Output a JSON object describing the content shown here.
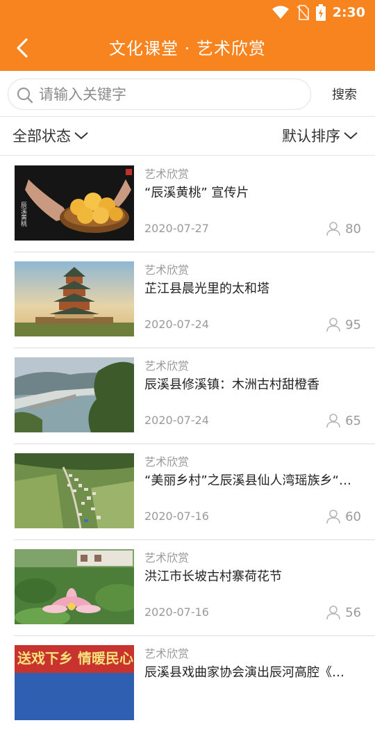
{
  "status_bar": {
    "time": "2:30"
  },
  "header": {
    "title": "文化课堂 · 艺术欣赏"
  },
  "search": {
    "placeholder": "请输入关键字",
    "button_label": "搜索"
  },
  "filters": {
    "status_label": "全部状态",
    "sort_label": "默认排序"
  },
  "items": [
    {
      "category": "艺术欣赏",
      "title": "“辰溪黄桃” 宣传片",
      "date": "2020-07-27",
      "views": "80"
    },
    {
      "category": "艺术欣赏",
      "title": "芷江县晨光里的太和塔",
      "date": "2020-07-24",
      "views": "95"
    },
    {
      "category": "艺术欣赏",
      "title": "辰溪县修溪镇：木洲古村甜橙香",
      "date": "2020-07-24",
      "views": "65"
    },
    {
      "category": "艺术欣赏",
      "title": "“美丽乡村”之辰溪县仙人湾瑶族乡“…",
      "date": "2020-07-16",
      "views": "60"
    },
    {
      "category": "艺术欣赏",
      "title": "洪江市长坡古村寨荷花节",
      "date": "2020-07-16",
      "views": "56"
    },
    {
      "category": "艺术欣赏",
      "title": "辰溪县戏曲家协会演出辰河高腔《…",
      "date": "",
      "views": ""
    }
  ],
  "thumbnail_captions": {
    "item_0": "辰溪黄桃",
    "item_5": "送戏下乡 情暖民心"
  },
  "colors": {
    "accent": "#f7841f",
    "text": "#222222",
    "muted": "#9a9a9a"
  }
}
